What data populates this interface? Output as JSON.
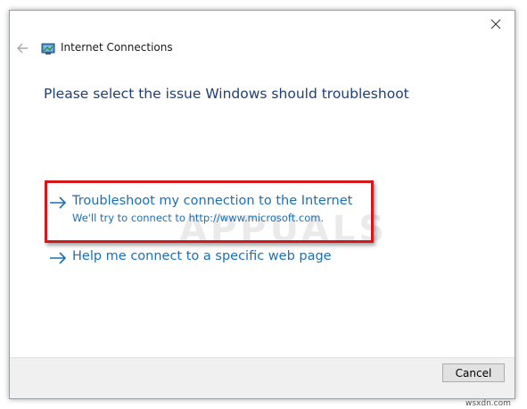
{
  "window": {
    "title": "Internet Connections",
    "heading": "Please select the issue Windows should troubleshoot"
  },
  "options": [
    {
      "label": "Troubleshoot my connection to the Internet",
      "description": "We'll try to connect to http://www.microsoft.com."
    },
    {
      "label": "Help me connect to a specific web page"
    }
  ],
  "footer": {
    "cancel_label": "Cancel"
  },
  "watermark": "APPUALS",
  "credit": "wsxdn.com",
  "colors": {
    "heading": "#1e3f73",
    "link": "#1b6fb8",
    "highlight": "#d7161b",
    "footer_bg": "#f0f0f0"
  },
  "icons": [
    "close-icon",
    "back-arrow-icon",
    "network-icon",
    "arrow-right-icon"
  ]
}
